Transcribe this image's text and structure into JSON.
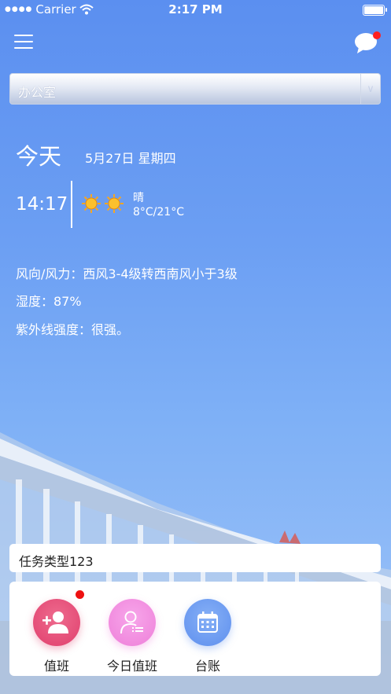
{
  "status_bar": {
    "carrier": "Carrier",
    "time": "2:17 PM"
  },
  "location_select": {
    "value": "办公室"
  },
  "weather": {
    "today_label": "今天",
    "date": "5月27日 星期四",
    "current_time": "14:17",
    "condition": "晴",
    "temperature": "8°C/21°C",
    "wind": "风向/风力：西风3-4级转西南风小于3级",
    "humidity": "湿度：87%",
    "uv": "紫外线强度：很强。"
  },
  "task_type": {
    "value": "任务类型123"
  },
  "apps": [
    {
      "label": "值班",
      "icon": "add-user-icon",
      "color": "#e8507a",
      "badge": true
    },
    {
      "label": "今日值班",
      "icon": "user-list-icon",
      "color": "#f38ee0",
      "badge": false
    },
    {
      "label": "台账",
      "icon": "calendar-icon",
      "color": "#6e9ef2",
      "badge": false
    }
  ],
  "colors": {
    "background_top": "#5b8ff0",
    "badge": "#ff2020"
  }
}
